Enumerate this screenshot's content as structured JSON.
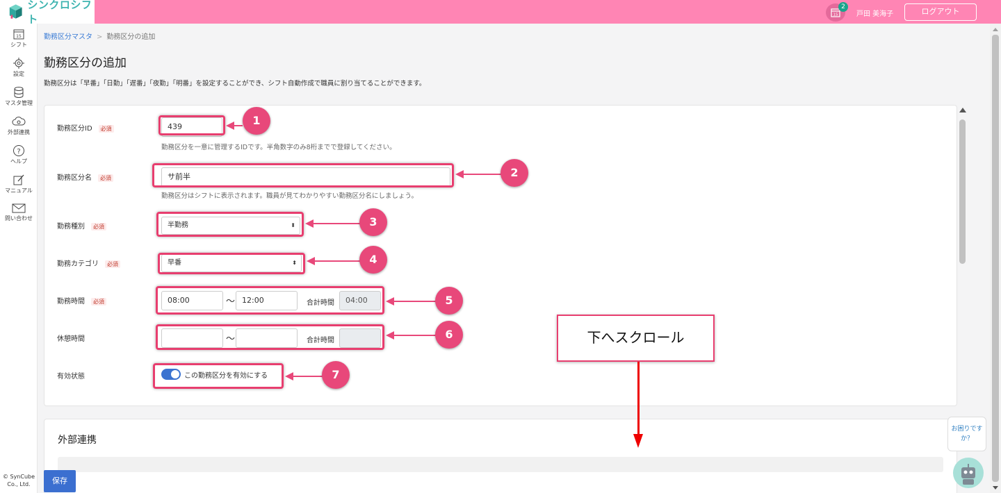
{
  "header": {
    "logo_text": "シンクロシフト",
    "notification_count": "2",
    "user_name": "戸田 美海子",
    "logout_label": "ログアウト",
    "calendar_day": "15"
  },
  "sidebar": {
    "items": [
      {
        "label": "シフト",
        "icon": "calendar-icon"
      },
      {
        "label": "設定",
        "icon": "gear-icon"
      },
      {
        "label": "マスタ管理",
        "icon": "database-icon"
      },
      {
        "label": "外部連携",
        "icon": "cloud-sync-icon"
      },
      {
        "label": "ヘルプ",
        "icon": "question-icon"
      },
      {
        "label": "マニュアル",
        "icon": "edit-icon"
      },
      {
        "label": "問い合わせ",
        "icon": "mail-icon"
      }
    ],
    "calendar_day": "15",
    "copyright": "© SynCube Co., Ltd."
  },
  "breadcrumb": {
    "parent": "勤務区分マスタ",
    "separator": ">",
    "current": "勤務区分の追加"
  },
  "page": {
    "title": "勤務区分の追加",
    "description": "勤務区分は「早番」「日勤」「遅番」「夜勤」「明番」を設定することができ、シフト自動作成で職員に割り当てることができます。"
  },
  "form": {
    "required_label": "必須",
    "id": {
      "label": "勤務区分ID",
      "value": "439",
      "hint": "勤務区分を一意に管理するIDです。半角数字のみ8桁までで登録してください。"
    },
    "name": {
      "label": "勤務区分名",
      "value": "サ前半",
      "hint": "勤務区分はシフトに表示されます。職員が見てわかりやすい勤務区分名にしましょう。"
    },
    "type": {
      "label": "勤務種別",
      "value": "半勤務"
    },
    "category": {
      "label": "勤務カテゴリ",
      "value": "早番"
    },
    "work_time": {
      "label": "勤務時間",
      "start": "08:00",
      "end": "12:00",
      "tilde": "〜",
      "total_label": "合計時間",
      "total": "04:00"
    },
    "break_time": {
      "label": "休憩時間",
      "start": "",
      "end": "",
      "tilde": "〜",
      "total_label": "合計時間",
      "total": ""
    },
    "status": {
      "label": "有効状態",
      "toggle_label": "この勤務区分を有効にする",
      "enabled": true
    }
  },
  "external": {
    "title": "外部連携"
  },
  "annotations": {
    "numbers": [
      "1",
      "2",
      "3",
      "4",
      "5",
      "6",
      "7"
    ],
    "scroll_note": "下へスクロール"
  },
  "help_bubble": "お困りですか？",
  "save_label": "保存",
  "colors": {
    "header": "#ff85b4",
    "accent": "#3b6fd0",
    "annotation": "#e8487a",
    "required": "#c0392b"
  }
}
